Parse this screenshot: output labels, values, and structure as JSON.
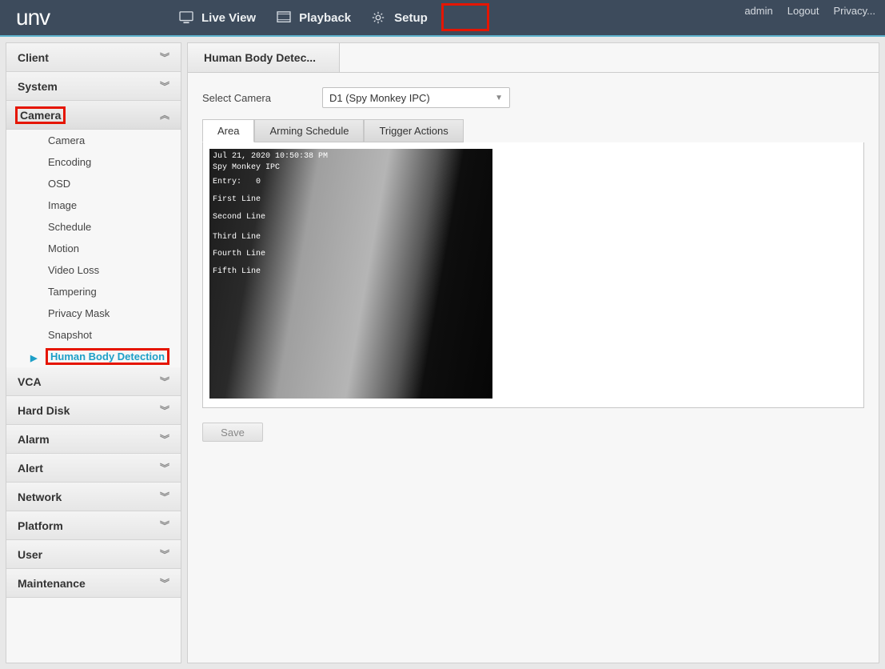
{
  "logo_text": "unv",
  "nav": {
    "live_view": "Live View",
    "playback": "Playback",
    "setup": "Setup"
  },
  "user_links": {
    "admin": "admin",
    "logout": "Logout",
    "privacy": "Privacy..."
  },
  "sidebar": {
    "client": "Client",
    "system": "System",
    "camera": "Camera",
    "camera_items": {
      "camera": "Camera",
      "encoding": "Encoding",
      "osd": "OSD",
      "image": "Image",
      "schedule": "Schedule",
      "motion": "Motion",
      "video_loss": "Video Loss",
      "tampering": "Tampering",
      "privacy_mask": "Privacy Mask",
      "snapshot": "Snapshot",
      "hbd": "Human Body Detection"
    },
    "vca": "VCA",
    "hard_disk": "Hard Disk",
    "alarm": "Alarm",
    "alert": "Alert",
    "network": "Network",
    "platform": "Platform",
    "user": "User",
    "maintenance": "Maintenance"
  },
  "page": {
    "title_tab": "Human Body Detec...",
    "select_camera_label": "Select Camera",
    "select_camera_value": "D1 (Spy Monkey IPC)",
    "tabs": {
      "area": "Area",
      "arming": "Arming Schedule",
      "trigger": "Trigger Actions"
    },
    "save": "Save"
  },
  "preview_overlay": {
    "ts": "Jul 21, 2020 10:50:38 PM",
    "name": "Spy Monkey IPC",
    "entry": "Entry:   0",
    "l1": "First Line",
    "l2": "Second Line",
    "l3": "Third Line",
    "l4": "Fourth Line",
    "l5": "Fifth Line"
  }
}
